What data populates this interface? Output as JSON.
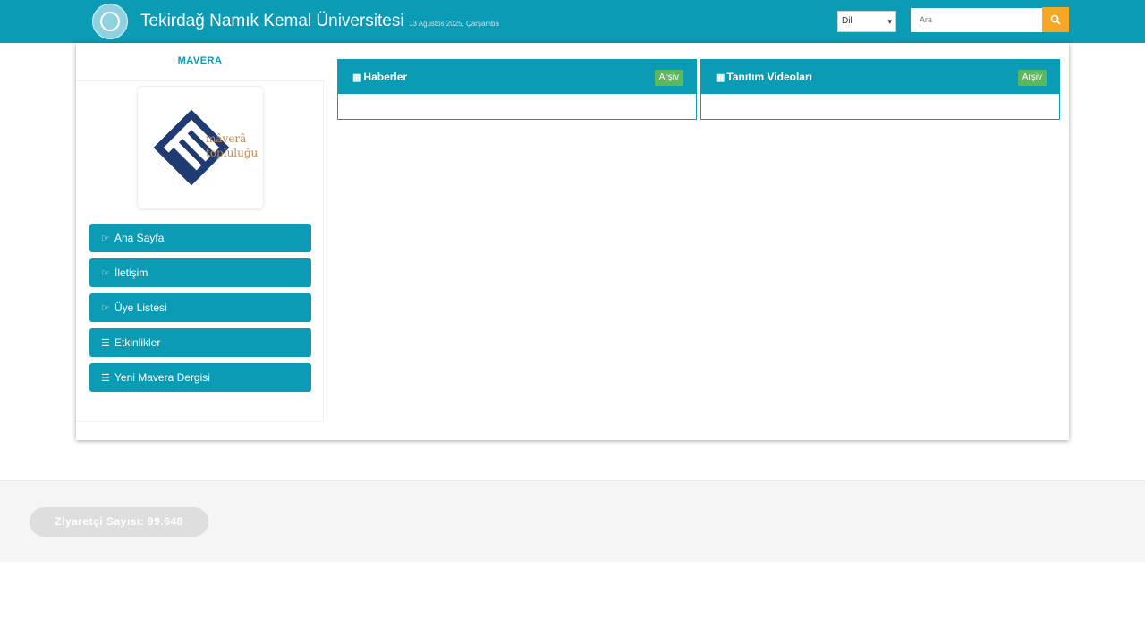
{
  "header": {
    "site_title": "Tekirdağ Namık Kemal Üniversitesi",
    "date": "13 Ağustos 2025, Çarşamba",
    "language": {
      "selected": "Dil"
    },
    "search": {
      "placeholder": "Ara"
    }
  },
  "sidebar": {
    "title": "MAVERA",
    "logo": {
      "line1": "mâverâ",
      "line2": "topluluğu"
    },
    "items": [
      {
        "icon": "pointing-hand-icon",
        "label": "Ana Sayfa"
      },
      {
        "icon": "pointing-hand-icon",
        "label": "İletişim"
      },
      {
        "icon": "pointing-hand-icon",
        "label": "Üye Listesi"
      },
      {
        "icon": "list-icon",
        "label": "Etkinlikler"
      },
      {
        "icon": "list-icon",
        "label": "Yeni Mavera Dergisi"
      }
    ]
  },
  "panels": [
    {
      "icon": "list-icon",
      "title": "Haberler",
      "action": "Arşiv"
    },
    {
      "icon": "list-icon",
      "title": "Tanıtım Videoları",
      "action": "Arşiv"
    }
  ],
  "footer": {
    "visitor_label": "Ziyaretçi Sayısı:",
    "visitor_count": "99.648"
  },
  "colors": {
    "brand": "#0b9bb5",
    "search_button": "#f5a623",
    "archive_button": "#5cb85c",
    "logo_blue": "#1f3b73",
    "logo_text": "#c0894e"
  }
}
